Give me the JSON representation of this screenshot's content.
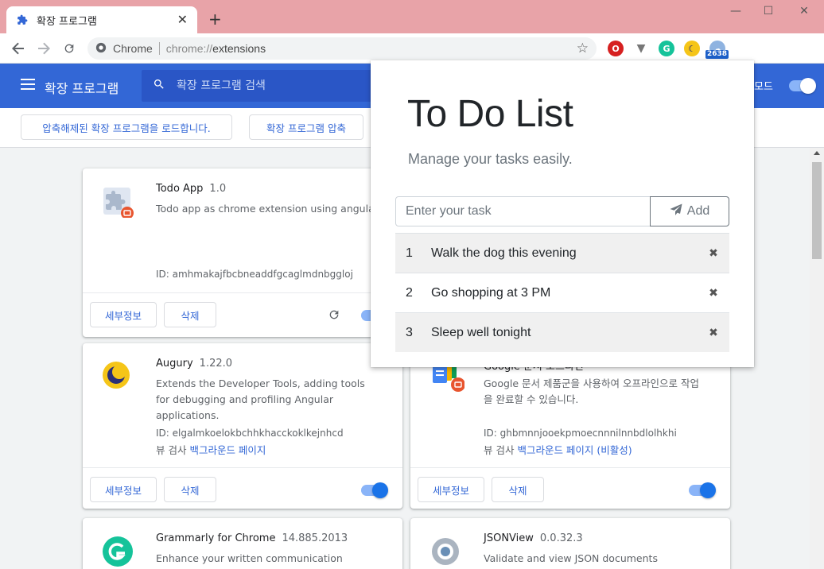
{
  "browser": {
    "tab_title": "확장 프로그램",
    "new_tab_label": "+",
    "site_label": "Chrome",
    "url_scheme": "chrome://",
    "url_host": "extensions",
    "extension_badge": "2638"
  },
  "extensions_page": {
    "title": "확장 프로그램",
    "search_placeholder": "확장 프로그램 검색",
    "dev_mode_label": "모드",
    "dev_mode_on": true,
    "load_unpacked_label": "압축해제된 확장 프로그램을 로드합니다.",
    "pack_label": "확장 프로그램 압축"
  },
  "cards": [
    {
      "name": "Todo App",
      "version": "1.0",
      "description": "Todo app as chrome extension using angular",
      "id": "ID: amhmakajfbcbneaddfgcaglmdnbggloj",
      "details_label": "세부정보",
      "remove_label": "삭제"
    },
    {
      "name": "Augury",
      "version": "1.22.0",
      "description": "Extends the Developer Tools, adding tools for debugging and profiling Angular applications.",
      "id": "ID: elgalmkoelokbchhkhacckoklkejnhcd",
      "views_prefix": "뷰 검사 ",
      "views_link": "백그라운드 페이지",
      "details_label": "세부정보",
      "remove_label": "삭제",
      "enabled": true
    },
    {
      "name": "Google 문서 오프라인",
      "version": "",
      "description": "Google 문서 제품군을 사용하여 오프라인으로 작업을 완료할 수 있습니다.",
      "id": "ID: ghbmnnjooekpmoecnnnilnnbdlolhkhi",
      "views_prefix": "뷰 검사 ",
      "views_link": "백그라운드 페이지 (비활성)",
      "details_label": "세부정보",
      "remove_label": "삭제",
      "enabled": true
    },
    {
      "name": "Grammarly for Chrome",
      "version": "14.885.2013",
      "description": "Enhance your written communication everywhere"
    },
    {
      "name": "JSONView",
      "version": "0.0.32.3",
      "description": "Validate and view JSON documents"
    }
  ],
  "popup": {
    "title": "To Do List",
    "subtitle": "Manage your tasks easily.",
    "input_placeholder": "Enter your task",
    "add_label": "Add",
    "tasks": [
      {
        "num": "1",
        "text": "Walk the dog this evening"
      },
      {
        "num": "2",
        "text": "Go shopping at 3 PM"
      },
      {
        "num": "3",
        "text": "Sleep well tonight"
      }
    ],
    "delete_glyph": "✖"
  },
  "colors": {
    "titlebar": "#e8a3a8",
    "header_blue": "#3367d6",
    "link_blue": "#3367d6",
    "toggle_knob": "#1a73e8",
    "toggle_track": "#8ab4f8"
  }
}
